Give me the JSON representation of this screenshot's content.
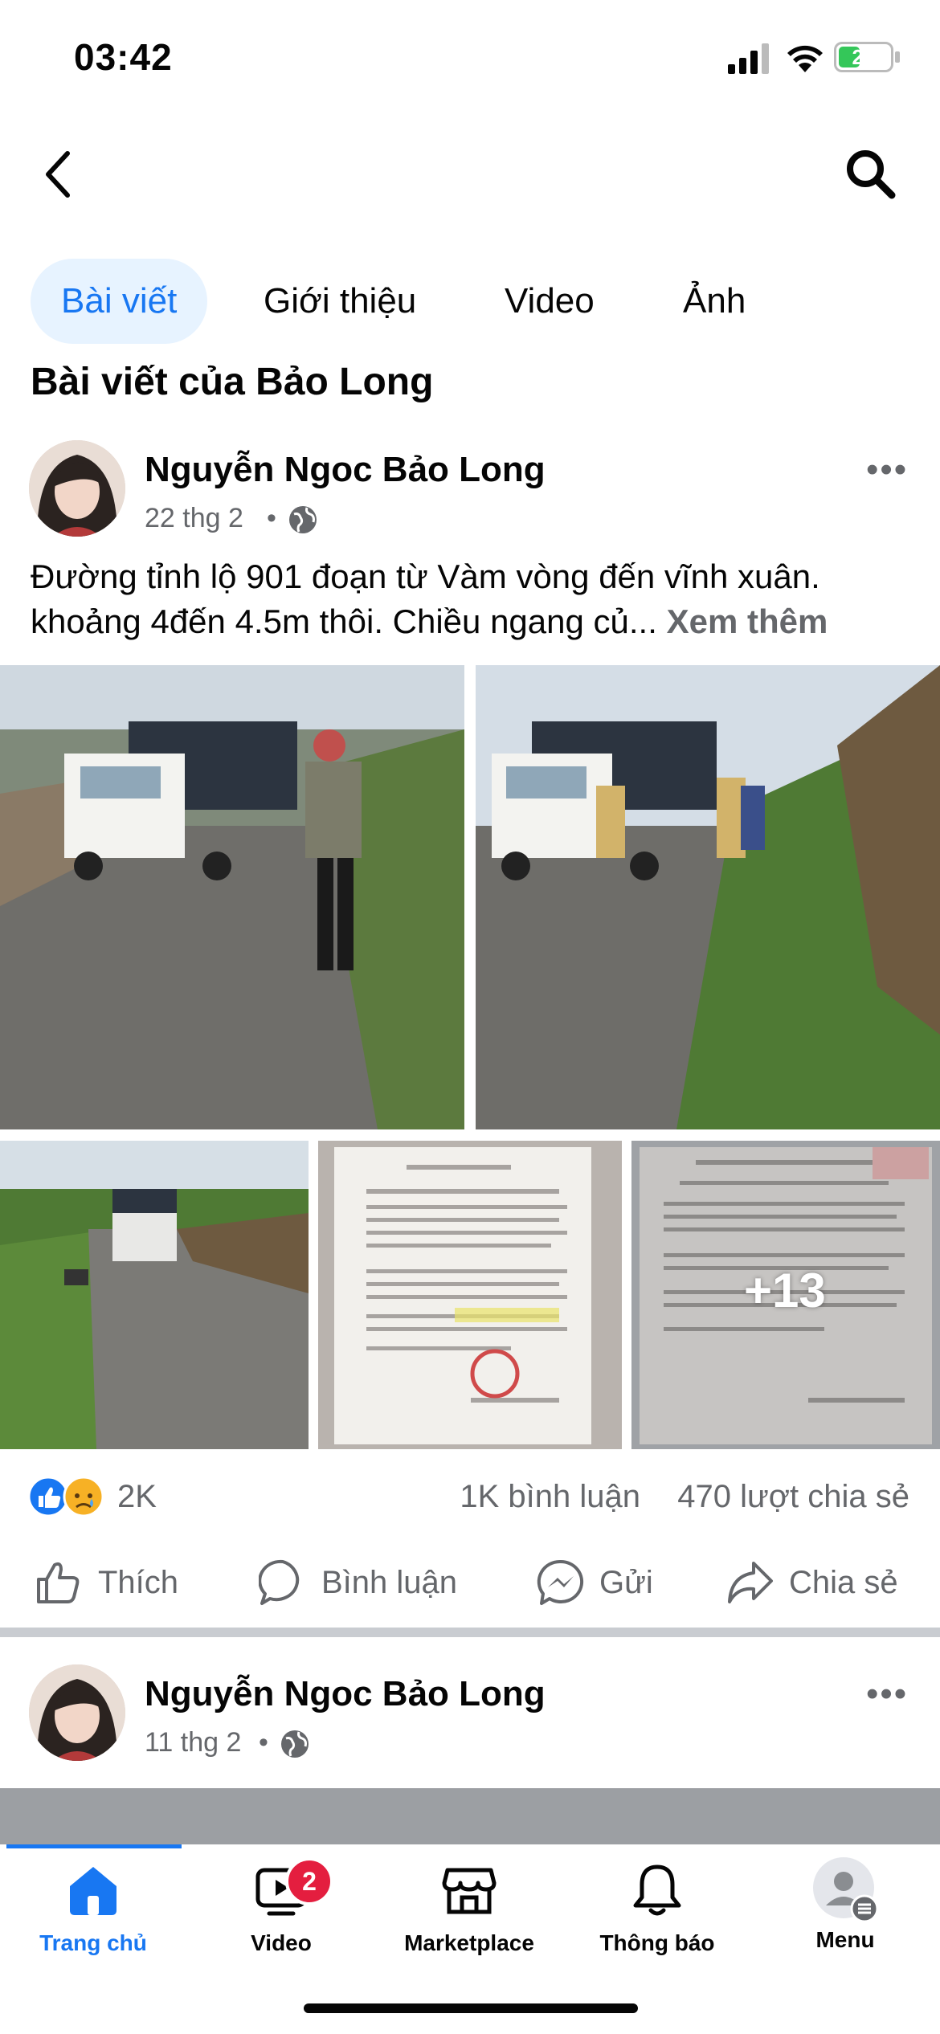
{
  "status": {
    "time": "03:42",
    "battery": "27"
  },
  "tabs": [
    {
      "label": "Bài viết",
      "active": true
    },
    {
      "label": "Giới thiệu"
    },
    {
      "label": "Video"
    },
    {
      "label": "Ảnh"
    }
  ],
  "section_title": "Bài viết của Bảo Long",
  "post": {
    "author": "Nguyễn Ngoc Bảo Long",
    "date": "22 thg 2",
    "text": "Đường tỉnh lộ 901 đoạn từ Vàm vòng đến vĩnh xuân. khoảng 4đến 4.5m thôi. Chiều ngang củ...",
    "see_more": "Xem thêm",
    "more_photos": "+13",
    "reaction_count": "2K",
    "comments": "1K bình luận",
    "shares": "470 lượt chia sẻ",
    "actions": {
      "like": "Thích",
      "comment": "Bình luận",
      "send": "Gửi",
      "share": "Chia sẻ"
    }
  },
  "post2": {
    "author": "Nguyễn Ngoc Bảo Long",
    "date": "11 thg 2"
  },
  "nav": {
    "home": "Trang chủ",
    "video": "Video",
    "video_badge": "2",
    "marketplace": "Marketplace",
    "notifications": "Thông báo",
    "menu": "Menu"
  },
  "colors": {
    "accent": "#1877f2",
    "badge": "#e41e3f",
    "secondary_text": "#65676b"
  }
}
